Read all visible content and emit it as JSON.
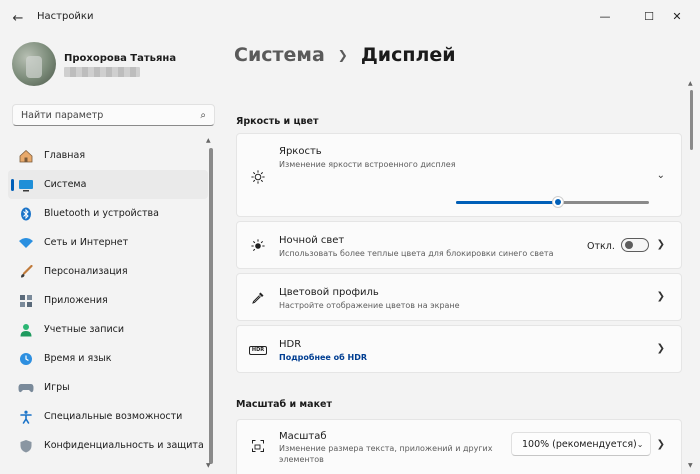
{
  "window": {
    "title": "Настройки"
  },
  "profile": {
    "name": "Прохорова Татьяна"
  },
  "search": {
    "placeholder": "Найти параметр"
  },
  "nav": [
    {
      "label": "Главная",
      "icon": "home-icon"
    },
    {
      "label": "Система",
      "icon": "monitor-icon",
      "active": true
    },
    {
      "label": "Bluetooth и устройства",
      "icon": "bluetooth-icon"
    },
    {
      "label": "Сеть и Интернет",
      "icon": "wifi-icon"
    },
    {
      "label": "Персонализация",
      "icon": "brush-icon"
    },
    {
      "label": "Приложения",
      "icon": "apps-icon"
    },
    {
      "label": "Учетные записи",
      "icon": "person-icon"
    },
    {
      "label": "Время и язык",
      "icon": "globe-clock-icon"
    },
    {
      "label": "Игры",
      "icon": "gamepad-icon"
    },
    {
      "label": "Специальные возможности",
      "icon": "accessibility-icon"
    },
    {
      "label": "Конфиденциальность и защита",
      "icon": "shield-icon"
    }
  ],
  "breadcrumb": {
    "parent": "Система",
    "current": "Дисплей"
  },
  "sections": {
    "brightness_color": "Яркость и цвет",
    "scale_layout": "Масштаб и макет"
  },
  "brightness": {
    "title": "Яркость",
    "subtitle": "Изменение яркости встроенного дисплея",
    "value_fraction": 0.53
  },
  "night_light": {
    "title": "Ночной свет",
    "subtitle": "Использовать более теплые цвета для блокировки синего света",
    "state": "Откл."
  },
  "color_profile": {
    "title": "Цветовой профиль",
    "subtitle": "Настройте отображение цветов на экране"
  },
  "hdr": {
    "title": "HDR",
    "link": "Подробнее об HDR",
    "icon_text": "HDR"
  },
  "scale": {
    "title": "Масштаб",
    "subtitle_line1": "Изменение размера текста, приложений и других",
    "subtitle_line2": "элементов",
    "value": "100% (рекомендуется)"
  },
  "colors": {
    "accent": "#005fb8",
    "background": "#f3f3f3",
    "card": "#fbfbfb"
  }
}
